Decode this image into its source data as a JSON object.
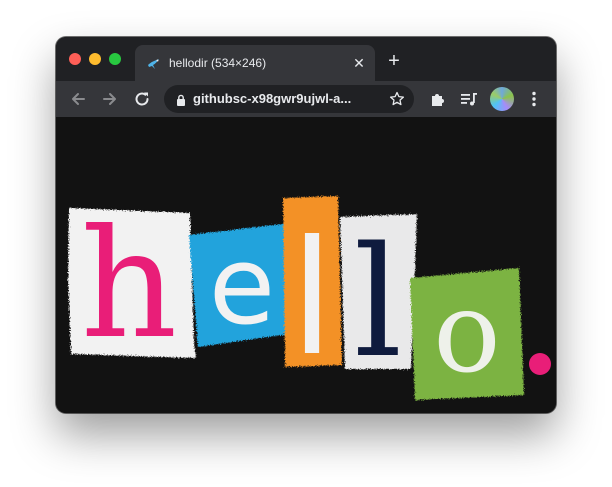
{
  "tab": {
    "title": "hellodir (534×246)"
  },
  "address_bar": {
    "url": "githubsc-x98gwr9ujwl-a..."
  },
  "page_image": {
    "text": "hello.",
    "letters": [
      "h",
      "e",
      "l",
      "l",
      "o"
    ],
    "colors": {
      "pink": "#e91e78",
      "blue": "#22a3dc",
      "orange": "#f39128",
      "navy": "#0f1b3e",
      "green": "#7cb342",
      "paper": "#f2f2f2"
    }
  },
  "icons": {
    "favicon": "hummingbird-icon",
    "back": "arrow-left-icon",
    "forward": "arrow-right-icon",
    "reload": "reload-icon",
    "lock": "lock-icon",
    "bookmark": "star-icon",
    "extensions": "puzzle-icon",
    "media": "media-queue-icon",
    "menu": "kebab-menu-icon"
  }
}
